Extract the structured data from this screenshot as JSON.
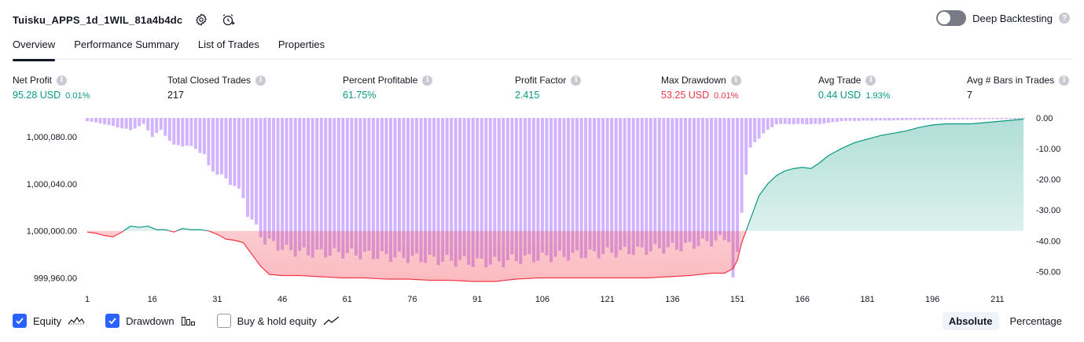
{
  "header": {
    "strategy_name": "Tuisku_APPS_1d_1WIL_81a4b4dc",
    "settings_icon": "settings-icon",
    "alert_icon": "add-alert-icon",
    "deep_backtesting_label": "Deep Backtesting",
    "deep_backtesting_enabled": false
  },
  "tabs": [
    {
      "label": "Overview",
      "active": true
    },
    {
      "label": "Performance Summary",
      "active": false
    },
    {
      "label": "List of Trades",
      "active": false
    },
    {
      "label": "Properties",
      "active": false
    }
  ],
  "metrics": {
    "net_profit": {
      "label": "Net Profit",
      "value": "95.28 USD",
      "pct": "0.01%"
    },
    "total_closed_trades": {
      "label": "Total Closed Trades",
      "value": "217"
    },
    "percent_profitable": {
      "label": "Percent Profitable",
      "value": "61.75%"
    },
    "profit_factor": {
      "label": "Profit Factor",
      "value": "2.415"
    },
    "max_drawdown": {
      "label": "Max Drawdown",
      "value": "53.25 USD",
      "pct": "0.01%"
    },
    "avg_trade": {
      "label": "Avg Trade",
      "value": "0.44 USD",
      "pct": "1.93%"
    },
    "avg_bars": {
      "label": "Avg # Bars in Trades",
      "value": "7"
    }
  },
  "chart_data": {
    "type": "line",
    "grid": false,
    "x_ticks": [
      "1",
      "16",
      "31",
      "46",
      "61",
      "76",
      "91",
      "106",
      "121",
      "136",
      "151",
      "166",
      "181",
      "196",
      "211"
    ],
    "left_axis": {
      "ticks": [
        "1,000,080.00",
        "1,000,040.00",
        "1,000,000.00",
        "999,960.00"
      ],
      "range": [
        999955,
        1000096
      ]
    },
    "right_axis": {
      "ticks": [
        "0.00",
        "-10.00",
        "-20.00",
        "-30.00",
        "-40.00",
        "-50.00"
      ],
      "range": [
        -54,
        0
      ]
    },
    "equity_baseline": 1000000,
    "equity": {
      "color_up": "#089981",
      "color_down": "#f23645",
      "points": [
        [
          1,
          999999
        ],
        [
          3,
          999998
        ],
        [
          5,
          999996
        ],
        [
          7,
          999995
        ],
        [
          9,
          999999
        ],
        [
          11,
          1000004
        ],
        [
          13,
          1000003
        ],
        [
          15,
          1000004
        ],
        [
          17,
          1000001
        ],
        [
          19,
          1000001
        ],
        [
          21,
          999999
        ],
        [
          23,
          1000002
        ],
        [
          25,
          1000001
        ],
        [
          27,
          1000001
        ],
        [
          29,
          1000000
        ],
        [
          31,
          999997
        ],
        [
          33,
          999993
        ],
        [
          35,
          999992
        ],
        [
          37,
          999990
        ],
        [
          39,
          999980
        ],
        [
          41,
          999970
        ],
        [
          43,
          999963
        ],
        [
          46,
          999962
        ],
        [
          50,
          999962
        ],
        [
          55,
          999961
        ],
        [
          60,
          999960
        ],
        [
          65,
          999960
        ],
        [
          70,
          999959
        ],
        [
          75,
          999959
        ],
        [
          80,
          999958
        ],
        [
          85,
          999958
        ],
        [
          90,
          999957
        ],
        [
          95,
          999957
        ],
        [
          100,
          999959
        ],
        [
          105,
          999960
        ],
        [
          110,
          999960
        ],
        [
          115,
          999960
        ],
        [
          120,
          999960
        ],
        [
          125,
          999960
        ],
        [
          130,
          999960
        ],
        [
          135,
          999961
        ],
        [
          140,
          999962
        ],
        [
          145,
          999964
        ],
        [
          148,
          999964
        ],
        [
          150,
          999968
        ],
        [
          151,
          999975
        ],
        [
          152,
          999990
        ],
        [
          154,
          1000010
        ],
        [
          156,
          1000030
        ],
        [
          158,
          1000040
        ],
        [
          160,
          1000047
        ],
        [
          162,
          1000051
        ],
        [
          164,
          1000053
        ],
        [
          166,
          1000054
        ],
        [
          168,
          1000053
        ],
        [
          170,
          1000058
        ],
        [
          172,
          1000064
        ],
        [
          175,
          1000070
        ],
        [
          178,
          1000075
        ],
        [
          181,
          1000078
        ],
        [
          184,
          1000081
        ],
        [
          187,
          1000083
        ],
        [
          190,
          1000085
        ],
        [
          193,
          1000088
        ],
        [
          196,
          1000090
        ],
        [
          199,
          1000091
        ],
        [
          202,
          1000091
        ],
        [
          205,
          1000091
        ],
        [
          208,
          1000092
        ],
        [
          211,
          1000093
        ],
        [
          214,
          1000094
        ],
        [
          217,
          1000095
        ]
      ]
    },
    "drawdown": {
      "color": "#d1b3ff",
      "key_points": [
        [
          1,
          -1
        ],
        [
          5,
          -2
        ],
        [
          8,
          -3
        ],
        [
          11,
          -4
        ],
        [
          14,
          -2
        ],
        [
          16,
          -6
        ],
        [
          18,
          -4
        ],
        [
          21,
          -9
        ],
        [
          24,
          -9
        ],
        [
          26,
          -10
        ],
        [
          28,
          -12
        ],
        [
          29,
          -16
        ],
        [
          31,
          -18
        ],
        [
          33,
          -20
        ],
        [
          35,
          -22
        ],
        [
          37,
          -26
        ],
        [
          38,
          -31
        ],
        [
          40,
          -36
        ],
        [
          42,
          -40
        ],
        [
          44,
          -41
        ],
        [
          47,
          -43
        ],
        [
          52,
          -44
        ],
        [
          60,
          -44
        ],
        [
          70,
          -45
        ],
        [
          80,
          -46
        ],
        [
          90,
          -47
        ],
        [
          96,
          -47
        ],
        [
          100,
          -46
        ],
        [
          110,
          -45
        ],
        [
          120,
          -44
        ],
        [
          130,
          -43
        ],
        [
          138,
          -42
        ],
        [
          142,
          -41
        ],
        [
          146,
          -40
        ],
        [
          149,
          -39
        ],
        [
          150,
          -53
        ],
        [
          151,
          -45
        ],
        [
          152,
          -30
        ],
        [
          153,
          -18
        ],
        [
          154,
          -10
        ],
        [
          155,
          -8
        ],
        [
          157,
          -5
        ],
        [
          160,
          -2
        ],
        [
          165,
          -2
        ],
        [
          170,
          -2
        ],
        [
          175,
          -1
        ],
        [
          200,
          -0.5
        ],
        [
          217,
          -0.3
        ]
      ]
    },
    "legend": [
      {
        "label": "Equity",
        "checked": true,
        "icon": "equity-line-icon"
      },
      {
        "label": "Drawdown",
        "checked": true,
        "icon": "drawdown-bars-icon"
      },
      {
        "label": "Buy & hold equity",
        "checked": false,
        "icon": "buyhold-line-icon"
      }
    ]
  },
  "view_modes": [
    {
      "label": "Absolute",
      "active": true
    },
    {
      "label": "Percentage",
      "active": false
    }
  ]
}
